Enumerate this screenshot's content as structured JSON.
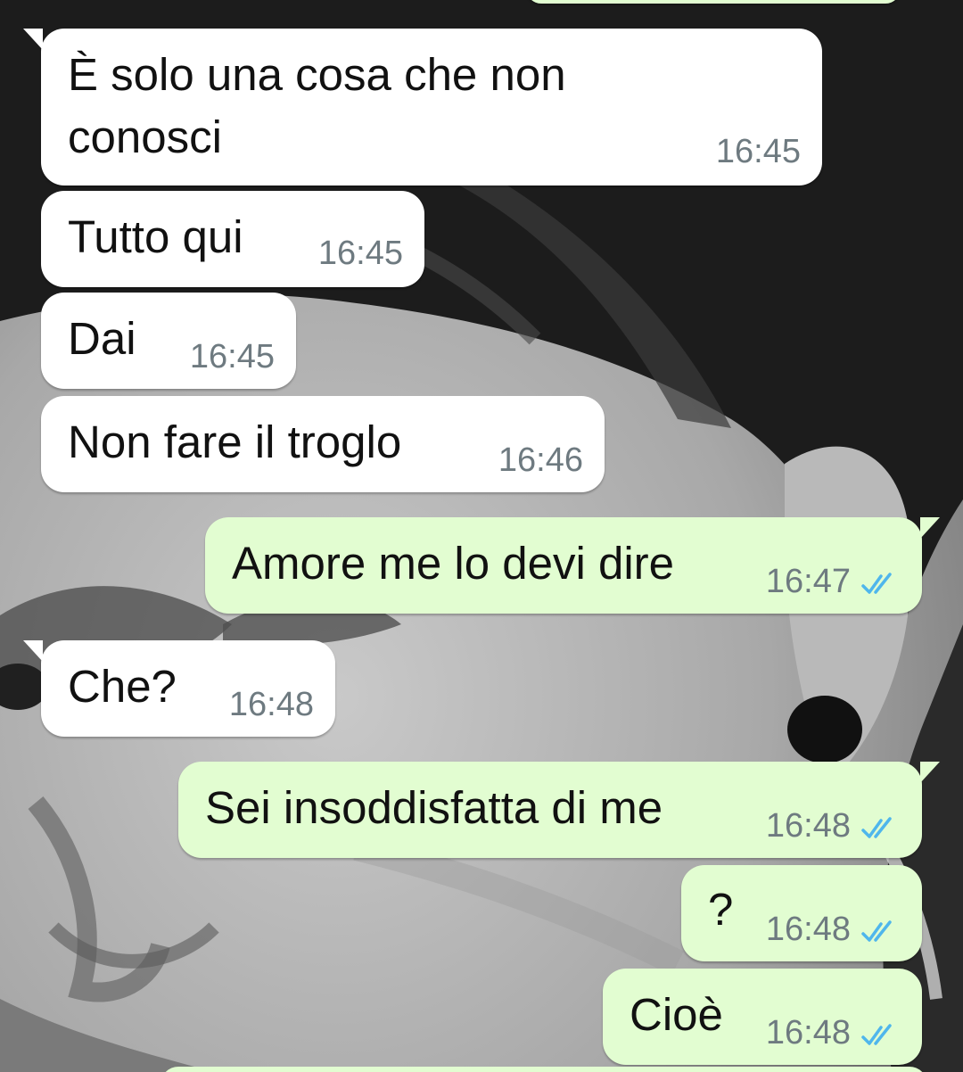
{
  "colors": {
    "incoming_bubble": "#ffffff",
    "outgoing_bubble": "#e2fdd1",
    "timestamp": "#6e7a80",
    "read_ticks": "#4fb6ec"
  },
  "background": {
    "icon": "photo-wallpaper-grayscale-portrait"
  },
  "messages": [
    {
      "direction": "in",
      "text_lines": [
        "È solo una cosa che non",
        "conosci"
      ],
      "time": "16:45"
    },
    {
      "direction": "in",
      "text": "Tutto qui",
      "time": "16:45"
    },
    {
      "direction": "in",
      "text": "Dai",
      "time": "16:45"
    },
    {
      "direction": "in",
      "text": "Non fare il troglo",
      "time": "16:46"
    },
    {
      "direction": "out",
      "text": "Amore me lo devi dire",
      "time": "16:47",
      "status": "read",
      "status_icon": "double-check-icon"
    },
    {
      "direction": "in",
      "text": "Che?",
      "time": "16:48"
    },
    {
      "direction": "out",
      "text": "Sei insoddisfatta di me",
      "time": "16:48",
      "status": "read",
      "status_icon": "double-check-icon"
    },
    {
      "direction": "out",
      "text": "?",
      "time": "16:48",
      "status": "read",
      "status_icon": "double-check-icon"
    },
    {
      "direction": "out",
      "text": "Cioè",
      "time": "16:48",
      "status": "read",
      "status_icon": "double-check-icon"
    }
  ]
}
